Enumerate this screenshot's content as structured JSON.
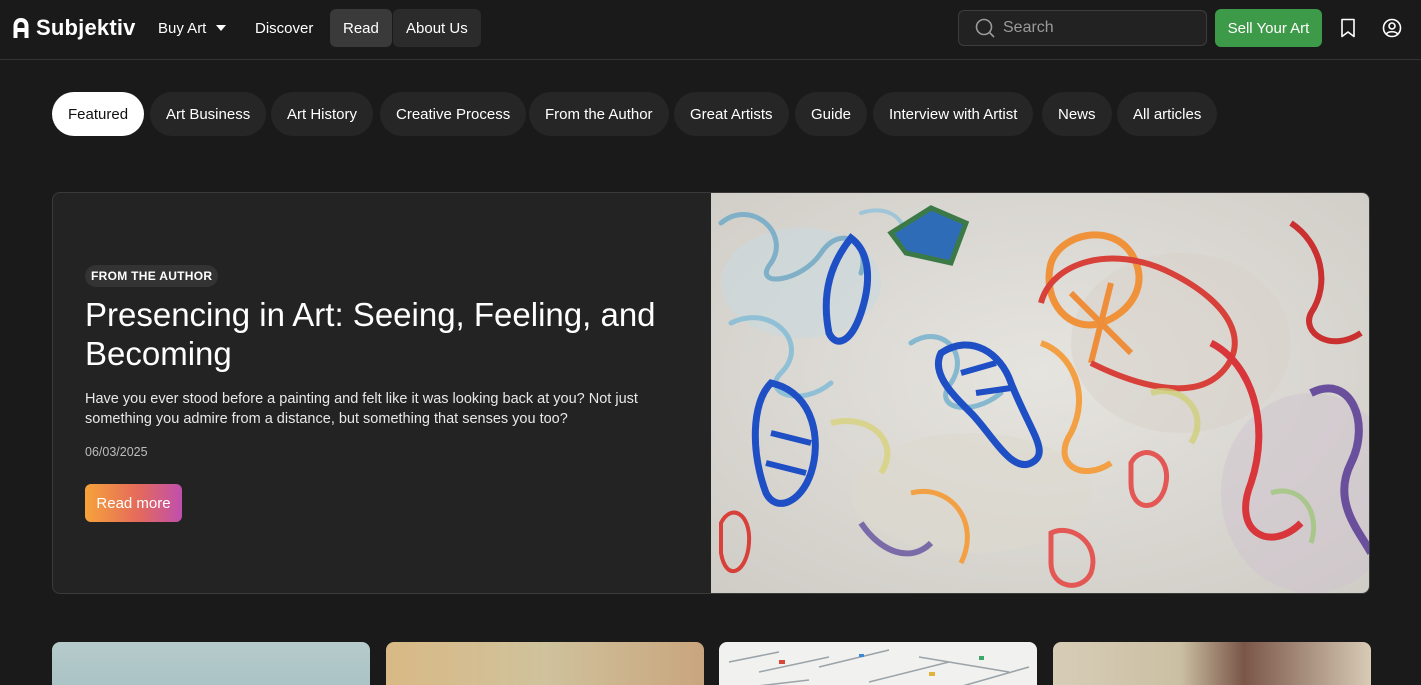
{
  "brand": {
    "name": "Subjektiv"
  },
  "nav": {
    "buy_art": "Buy Art",
    "discover": "Discover",
    "read": "Read",
    "about_us": "About Us"
  },
  "search": {
    "placeholder": "Search"
  },
  "sell_button": "Sell Your Art",
  "categories": [
    {
      "label": "Featured",
      "active": true
    },
    {
      "label": "Art Business",
      "active": false
    },
    {
      "label": "Art History",
      "active": false
    },
    {
      "label": "Creative Process",
      "active": false
    },
    {
      "label": "From the Author",
      "active": false
    },
    {
      "label": "Great Artists",
      "active": false
    },
    {
      "label": "Guide",
      "active": false
    },
    {
      "label": "Interview with Artist",
      "active": false
    },
    {
      "label": "News",
      "active": false
    },
    {
      "label": "All articles",
      "active": false
    }
  ],
  "featured": {
    "badge": "FROM THE AUTHOR",
    "title": "Presencing in Art: Seeing, Feeling, and Becoming",
    "excerpt": "Have you ever stood before a painting and felt like it was looking back at you? Not just something you admire from a distance, but something that senses you too?",
    "date": "06/03/2025",
    "cta": "Read more"
  },
  "colors": {
    "background": "#1a1a1a",
    "sell_button": "#3d9a48",
    "active_pill": "#ffffff"
  },
  "icons": [
    "search-icon",
    "bookmark-icon",
    "account-icon",
    "chevron-down-icon"
  ]
}
